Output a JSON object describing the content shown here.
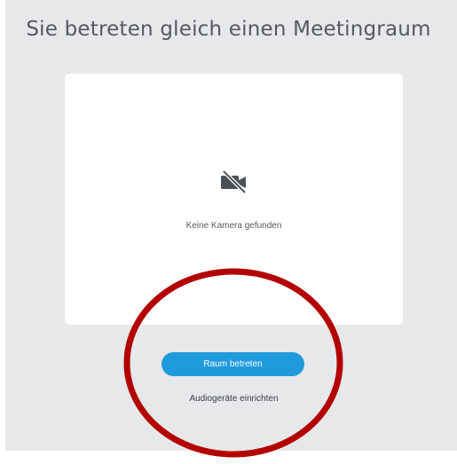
{
  "page": {
    "title": "Sie betreten gleich einen Meetingraum"
  },
  "preview": {
    "camera_icon": "camera-off-icon",
    "status_text": "Keine Kamera gefunden"
  },
  "actions": {
    "join_label": "Raum betreten",
    "audio_setup_label": "Audiogeräte einrichten"
  },
  "colors": {
    "background": "#e6e8ea",
    "card": "#ffffff",
    "accent": "#1f9bdc",
    "annotation": "#b30000"
  }
}
